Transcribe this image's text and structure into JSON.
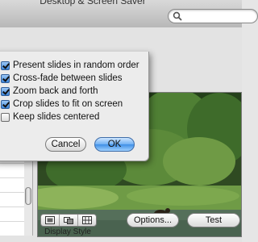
{
  "window": {
    "title": "Desktop & Screen Saver"
  },
  "search": {
    "placeholder": "",
    "icon": "search-icon"
  },
  "options_sheet": {
    "checkboxes": [
      {
        "label": "Present slides in random order",
        "checked": true
      },
      {
        "label": "Cross-fade between slides",
        "checked": true
      },
      {
        "label": "Zoom back and forth",
        "checked": true
      },
      {
        "label": "Crop slides to fit on screen",
        "checked": true
      },
      {
        "label": "Keep slides centered",
        "checked": false
      }
    ],
    "cancel_label": "Cancel",
    "ok_label": "OK"
  },
  "bottom_bar": {
    "display_style_caption": "Display Style",
    "display_style_options": [
      "slideshow-icon",
      "collage-icon",
      "mosaic-icon"
    ],
    "options_label": "Options...",
    "test_label": "Test"
  },
  "colors": {
    "default_button": "#3f8fe6",
    "checkbox_checked": "#3d86da"
  }
}
